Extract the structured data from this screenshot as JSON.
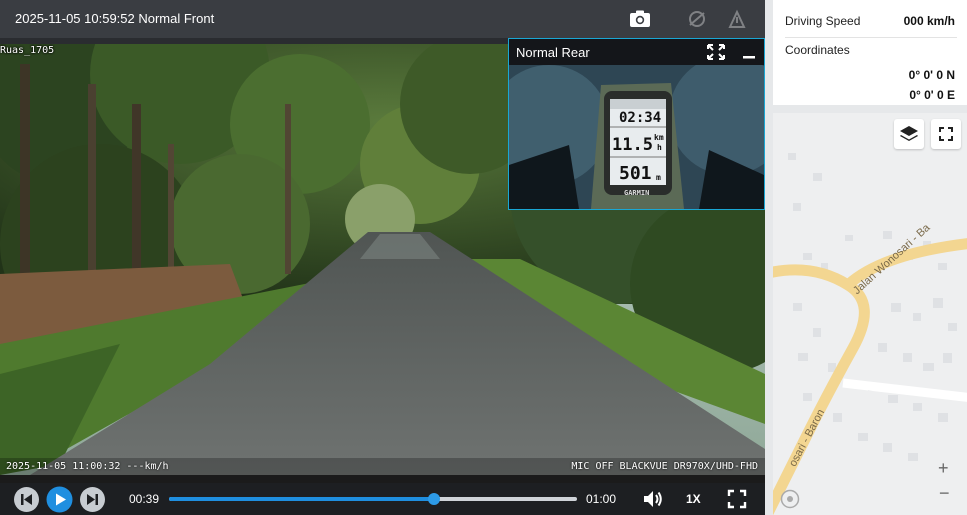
{
  "player": {
    "front_title": "2025-11-05 10:59:52 Normal Front",
    "segment_label": "Ruas_1705",
    "overlay_left": "2025-11-05 11:00:32 ---km/h",
    "overlay_right": "MIC OFF BLACKVUE DR970X/UHD-FHD",
    "rear_title": "Normal Rear",
    "rear_gps": {
      "time": "02:34",
      "speed": "11.5",
      "speed_unit_top": "km",
      "speed_unit_bottom": "h",
      "distance": "501",
      "distance_unit": "m",
      "brand": "GARMIN"
    },
    "controls": {
      "current_time": "00:39",
      "total_time": "01:00",
      "progress": 0.65,
      "speed": "1X"
    }
  },
  "info": {
    "driving_speed_label": "Driving Speed",
    "driving_speed_value": "000 km/h",
    "coordinates_label": "Coordinates",
    "latitude": "0° 0'  0 N",
    "longitude": "0° 0'  0 E"
  },
  "map": {
    "road_1": "Jalan Wonosari - Ba",
    "road_2": "osari - Baron",
    "zoom_in": "+",
    "zoom_out": "−"
  },
  "icons": {
    "camera": "camera-icon",
    "gsensor": "g-sensor-icon",
    "tilt": "tilt-icon",
    "pip_expand": "expand-icon",
    "pip_minimize": "minimize-icon",
    "prev": "skip-previous-icon",
    "play": "play-icon",
    "next": "skip-next-icon",
    "volume": "volume-icon",
    "fullscreen": "fullscreen-icon",
    "layers": "layers-icon",
    "compass": "compass-icon"
  },
  "colors": {
    "accent": "#1f8fe0",
    "pip_border": "#1aa7d4",
    "road": "#f6d68a",
    "control_bg": "#1d1f22"
  }
}
